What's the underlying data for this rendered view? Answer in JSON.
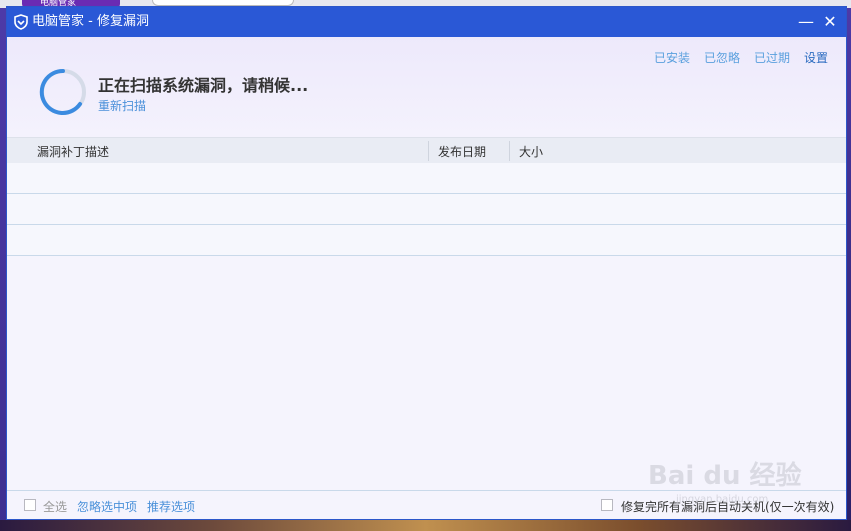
{
  "window": {
    "title": "电脑管家 - 修复漏洞",
    "minimize_symbol": "—",
    "close_symbol": "✕"
  },
  "background": {
    "tab_label": "电脑管家"
  },
  "header": {
    "links": [
      "已安装",
      "已忽略",
      "已过期",
      "设置"
    ],
    "scan_status": "正在扫描系统漏洞，请稍候...",
    "rescan_label": "重新扫描"
  },
  "table": {
    "columns": [
      "漏洞补丁描述",
      "发布日期",
      "大小"
    ],
    "row_count": 3
  },
  "footer": {
    "select_all_label": "全选",
    "select_all_checked": false,
    "ignore_selected_label": "忽略选中项",
    "recommend_label": "推荐选项",
    "auto_shutdown_label": "修复完所有漏洞后自动关机(仅一次有效)",
    "auto_shutdown_checked": false
  },
  "colors": {
    "titlebar": "#2a58d6",
    "link": "#5aa0de",
    "accent_link": "#4a90d9",
    "spinner": "#3b8be0"
  },
  "watermark": {
    "text": "Bai du 经验",
    "sub": "jingyan.baidu.com"
  }
}
